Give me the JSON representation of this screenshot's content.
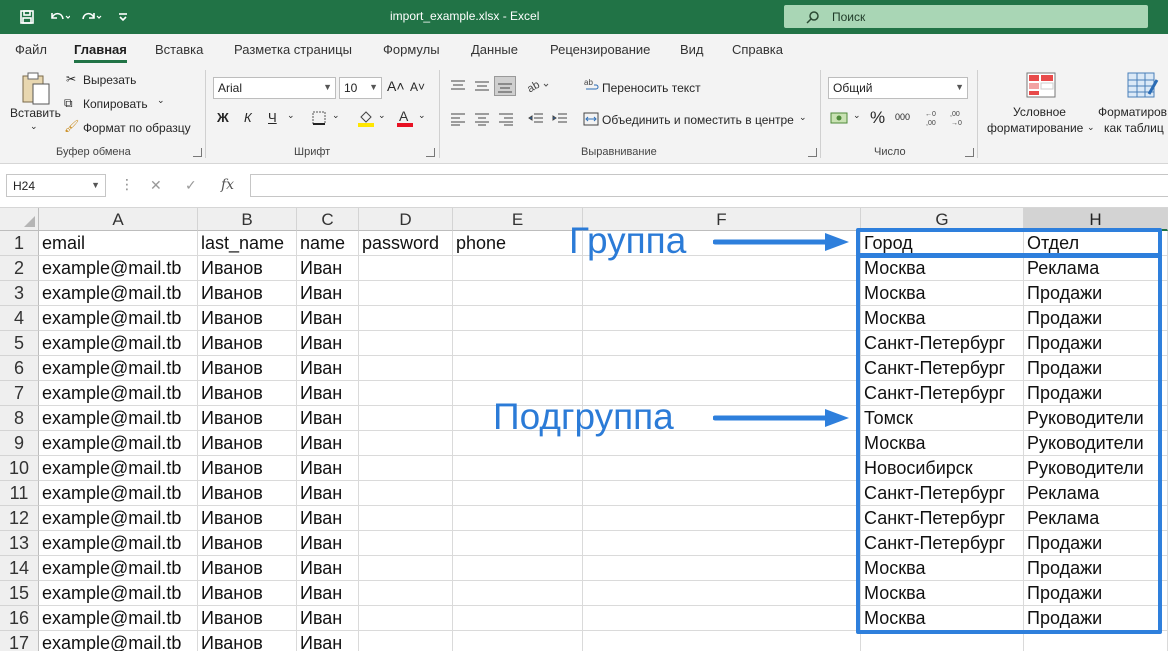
{
  "window": {
    "title": "import_example.xlsx  -  Excel",
    "search_placeholder": "Поиск"
  },
  "ribbon_tabs": [
    "Файл",
    "Главная",
    "Вставка",
    "Разметка страницы",
    "Формулы",
    "Данные",
    "Рецензирование",
    "Вид",
    "Справка"
  ],
  "ribbon": {
    "clipboard": {
      "paste": "Вставить",
      "cut": "Вырезать",
      "copy": "Копировать",
      "format_painter": "Формат по образцу",
      "group": "Буфер обмена"
    },
    "font": {
      "name": "Arial",
      "size": "10",
      "bold": "Ж",
      "italic": "К",
      "underline": "Ч",
      "group": "Шрифт"
    },
    "alignment": {
      "wrap": "Переносить текст",
      "merge": "Объединить и поместить в центре",
      "group": "Выравнивание"
    },
    "number": {
      "format": "Общий",
      "group": "Число"
    },
    "styles": {
      "conditional_line1": "Условное",
      "conditional_line2": "форматирование",
      "table_line1": "Форматиров",
      "table_line2": "как таблиц"
    }
  },
  "formula_bar": {
    "name_box": "H24",
    "value": ""
  },
  "sheet": {
    "columns": [
      "A",
      "B",
      "C",
      "D",
      "E",
      "F",
      "G",
      "H"
    ],
    "selected_column": "H",
    "row_numbers": [
      "1",
      "2",
      "3",
      "4",
      "5",
      "6",
      "7",
      "8",
      "9",
      "10",
      "11",
      "12",
      "13",
      "14",
      "15",
      "16",
      "17"
    ],
    "rows": [
      [
        "email",
        "last_name",
        "name",
        "password",
        "phone",
        "",
        "Город",
        "Отдел"
      ],
      [
        "example@mail.tb",
        "Иванов",
        "Иван",
        "",
        "",
        "",
        "Москва",
        "Реклама"
      ],
      [
        "example@mail.tb",
        "Иванов",
        "Иван",
        "",
        "",
        "",
        "Москва",
        "Продажи"
      ],
      [
        "example@mail.tb",
        "Иванов",
        "Иван",
        "",
        "",
        "",
        "Москва",
        "Продажи"
      ],
      [
        "example@mail.tb",
        "Иванов",
        "Иван",
        "",
        "",
        "",
        "Санкт-Петербург",
        "Продажи"
      ],
      [
        "example@mail.tb",
        "Иванов",
        "Иван",
        "",
        "",
        "",
        "Санкт-Петербург",
        "Продажи"
      ],
      [
        "example@mail.tb",
        "Иванов",
        "Иван",
        "",
        "",
        "",
        "Санкт-Петербург",
        "Продажи"
      ],
      [
        "example@mail.tb",
        "Иванов",
        "Иван",
        "",
        "",
        "",
        "Томск",
        "Руководители"
      ],
      [
        "example@mail.tb",
        "Иванов",
        "Иван",
        "",
        "",
        "",
        "Москва",
        "Руководители"
      ],
      [
        "example@mail.tb",
        "Иванов",
        "Иван",
        "",
        "",
        "",
        "Новосибирск",
        "Руководители"
      ],
      [
        "example@mail.tb",
        "Иванов",
        "Иван",
        "",
        "",
        "",
        "Санкт-Петербург",
        "Реклама"
      ],
      [
        "example@mail.tb",
        "Иванов",
        "Иван",
        "",
        "",
        "",
        "Санкт-Петербург",
        "Реклама"
      ],
      [
        "example@mail.tb",
        "Иванов",
        "Иван",
        "",
        "",
        "",
        "Санкт-Петербург",
        "Продажи"
      ],
      [
        "example@mail.tb",
        "Иванов",
        "Иван",
        "",
        "",
        "",
        "Москва",
        "Продажи"
      ],
      [
        "example@mail.tb",
        "Иванов",
        "Иван",
        "",
        "",
        "",
        "Москва",
        "Продажи"
      ],
      [
        "example@mail.tb",
        "Иванов",
        "Иван",
        "",
        "",
        "",
        "Москва",
        "Продажи"
      ],
      [
        "example@mail.tb",
        "Иванов",
        "Иван",
        "",
        "",
        "",
        "",
        ""
      ]
    ]
  },
  "annotations": {
    "group_label": "Группа",
    "subgroup_label": "Подгруппа",
    "color": "#2e7fdc"
  },
  "colors": {
    "excel_green": "#217346",
    "search_bg": "#a9d6b5"
  }
}
